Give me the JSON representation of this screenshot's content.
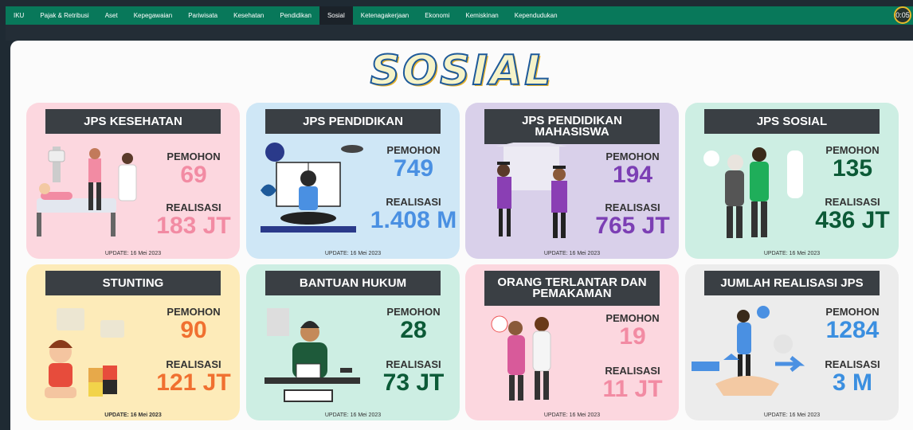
{
  "nav": {
    "items": [
      "IKU",
      "Pajak & Retribusi",
      "Aset",
      "Kepegawaian",
      "Pariwisata",
      "Kesehatan",
      "Pendidikan",
      "Sosial",
      "Ketenagakerjaan",
      "Ekonomi",
      "Kemiskinan",
      "Kependudukan"
    ],
    "active_index": 7,
    "timer": "0:05"
  },
  "page_title": "SOSIAL",
  "colors": {
    "pink": "#f28ba3",
    "blue": "#4a90e2",
    "purple": "#7c3fb4",
    "green": "#0c5a37",
    "orange": "#f07030",
    "title_fill": "#f5f3c9",
    "title_stroke": "#1e5a9a"
  },
  "cards": [
    {
      "title": "JPS KESEHATAN",
      "pemohon_label": "PEMOHON",
      "pemohon": "69",
      "realisasi_label": "REALISASI",
      "realisasi": "183 JT",
      "update": "UPDATE: 16 Mei 2023"
    },
    {
      "title": "JPS PENDIDIKAN",
      "pemohon_label": "PEMOHON",
      "pemohon": "749",
      "realisasi_label": "REALISASI",
      "realisasi": "1.408 M",
      "update": "UPDATE: 16 Mei 2023"
    },
    {
      "title": "JPS PENDIDIKAN MAHASISWA",
      "pemohon_label": "PEMOHON",
      "pemohon": "194",
      "realisasi_label": "REALISASI",
      "realisasi": "765 JT",
      "update": "UPDATE: 16 Mei 2023"
    },
    {
      "title": "JPS SOSIAL",
      "pemohon_label": "PEMOHON",
      "pemohon": "135",
      "realisasi_label": "REALISASI",
      "realisasi": "436 JT",
      "update": "UPDATE: 16 Mei 2023"
    },
    {
      "title": "STUNTING",
      "pemohon_label": "PEMOHON",
      "pemohon": "90",
      "realisasi_label": "REALISASI",
      "realisasi": "121 JT",
      "update": "UPDATE: 16 Mei 2023"
    },
    {
      "title": "BANTUAN HUKUM",
      "pemohon_label": "PEMOHON",
      "pemohon": "28",
      "realisasi_label": "REALISASI",
      "realisasi": "73 JT",
      "update": "UPDATE: 16 Mei 2023"
    },
    {
      "title": "ORANG TERLANTAR DAN PEMAKAMAN",
      "pemohon_label": "PEMOHON",
      "pemohon": "19",
      "realisasi_label": "REALISASI",
      "realisasi": "11 JT",
      "update": "UPDATE: 16 Mei 2023"
    },
    {
      "title": "JUMLAH REALISASI JPS",
      "pemohon_label": "PEMOHON",
      "pemohon": "1284",
      "realisasi_label": "REALISASI",
      "realisasi": "3 M",
      "update": "UPDATE: 16 Mei 2023"
    }
  ]
}
